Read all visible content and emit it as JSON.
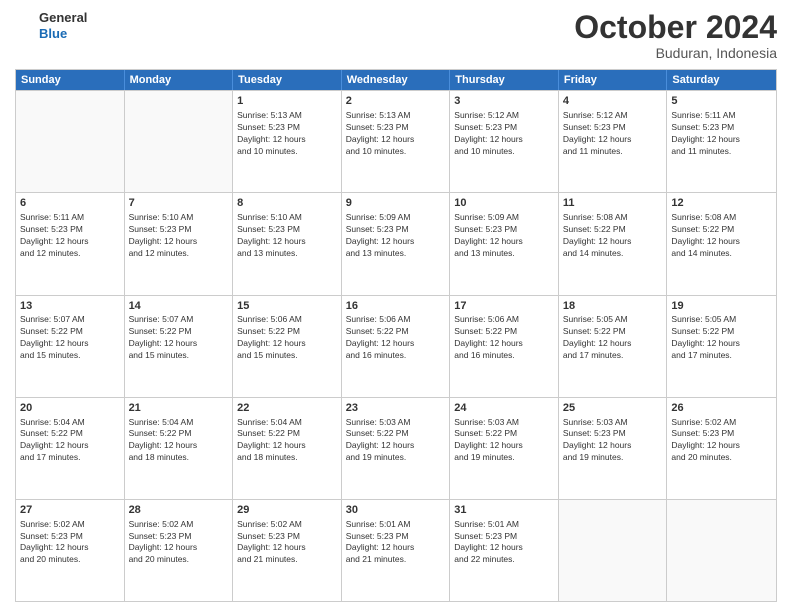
{
  "logo": {
    "line1": "General",
    "line2": "Blue"
  },
  "header": {
    "month": "October 2024",
    "location": "Buduran, Indonesia"
  },
  "days_of_week": [
    "Sunday",
    "Monday",
    "Tuesday",
    "Wednesday",
    "Thursday",
    "Friday",
    "Saturday"
  ],
  "weeks": [
    [
      {
        "day": "",
        "info": ""
      },
      {
        "day": "",
        "info": ""
      },
      {
        "day": "1",
        "info": "Sunrise: 5:13 AM\nSunset: 5:23 PM\nDaylight: 12 hours\nand 10 minutes."
      },
      {
        "day": "2",
        "info": "Sunrise: 5:13 AM\nSunset: 5:23 PM\nDaylight: 12 hours\nand 10 minutes."
      },
      {
        "day": "3",
        "info": "Sunrise: 5:12 AM\nSunset: 5:23 PM\nDaylight: 12 hours\nand 10 minutes."
      },
      {
        "day": "4",
        "info": "Sunrise: 5:12 AM\nSunset: 5:23 PM\nDaylight: 12 hours\nand 11 minutes."
      },
      {
        "day": "5",
        "info": "Sunrise: 5:11 AM\nSunset: 5:23 PM\nDaylight: 12 hours\nand 11 minutes."
      }
    ],
    [
      {
        "day": "6",
        "info": "Sunrise: 5:11 AM\nSunset: 5:23 PM\nDaylight: 12 hours\nand 12 minutes."
      },
      {
        "day": "7",
        "info": "Sunrise: 5:10 AM\nSunset: 5:23 PM\nDaylight: 12 hours\nand 12 minutes."
      },
      {
        "day": "8",
        "info": "Sunrise: 5:10 AM\nSunset: 5:23 PM\nDaylight: 12 hours\nand 13 minutes."
      },
      {
        "day": "9",
        "info": "Sunrise: 5:09 AM\nSunset: 5:23 PM\nDaylight: 12 hours\nand 13 minutes."
      },
      {
        "day": "10",
        "info": "Sunrise: 5:09 AM\nSunset: 5:23 PM\nDaylight: 12 hours\nand 13 minutes."
      },
      {
        "day": "11",
        "info": "Sunrise: 5:08 AM\nSunset: 5:22 PM\nDaylight: 12 hours\nand 14 minutes."
      },
      {
        "day": "12",
        "info": "Sunrise: 5:08 AM\nSunset: 5:22 PM\nDaylight: 12 hours\nand 14 minutes."
      }
    ],
    [
      {
        "day": "13",
        "info": "Sunrise: 5:07 AM\nSunset: 5:22 PM\nDaylight: 12 hours\nand 15 minutes."
      },
      {
        "day": "14",
        "info": "Sunrise: 5:07 AM\nSunset: 5:22 PM\nDaylight: 12 hours\nand 15 minutes."
      },
      {
        "day": "15",
        "info": "Sunrise: 5:06 AM\nSunset: 5:22 PM\nDaylight: 12 hours\nand 15 minutes."
      },
      {
        "day": "16",
        "info": "Sunrise: 5:06 AM\nSunset: 5:22 PM\nDaylight: 12 hours\nand 16 minutes."
      },
      {
        "day": "17",
        "info": "Sunrise: 5:06 AM\nSunset: 5:22 PM\nDaylight: 12 hours\nand 16 minutes."
      },
      {
        "day": "18",
        "info": "Sunrise: 5:05 AM\nSunset: 5:22 PM\nDaylight: 12 hours\nand 17 minutes."
      },
      {
        "day": "19",
        "info": "Sunrise: 5:05 AM\nSunset: 5:22 PM\nDaylight: 12 hours\nand 17 minutes."
      }
    ],
    [
      {
        "day": "20",
        "info": "Sunrise: 5:04 AM\nSunset: 5:22 PM\nDaylight: 12 hours\nand 17 minutes."
      },
      {
        "day": "21",
        "info": "Sunrise: 5:04 AM\nSunset: 5:22 PM\nDaylight: 12 hours\nand 18 minutes."
      },
      {
        "day": "22",
        "info": "Sunrise: 5:04 AM\nSunset: 5:22 PM\nDaylight: 12 hours\nand 18 minutes."
      },
      {
        "day": "23",
        "info": "Sunrise: 5:03 AM\nSunset: 5:22 PM\nDaylight: 12 hours\nand 19 minutes."
      },
      {
        "day": "24",
        "info": "Sunrise: 5:03 AM\nSunset: 5:22 PM\nDaylight: 12 hours\nand 19 minutes."
      },
      {
        "day": "25",
        "info": "Sunrise: 5:03 AM\nSunset: 5:23 PM\nDaylight: 12 hours\nand 19 minutes."
      },
      {
        "day": "26",
        "info": "Sunrise: 5:02 AM\nSunset: 5:23 PM\nDaylight: 12 hours\nand 20 minutes."
      }
    ],
    [
      {
        "day": "27",
        "info": "Sunrise: 5:02 AM\nSunset: 5:23 PM\nDaylight: 12 hours\nand 20 minutes."
      },
      {
        "day": "28",
        "info": "Sunrise: 5:02 AM\nSunset: 5:23 PM\nDaylight: 12 hours\nand 20 minutes."
      },
      {
        "day": "29",
        "info": "Sunrise: 5:02 AM\nSunset: 5:23 PM\nDaylight: 12 hours\nand 21 minutes."
      },
      {
        "day": "30",
        "info": "Sunrise: 5:01 AM\nSunset: 5:23 PM\nDaylight: 12 hours\nand 21 minutes."
      },
      {
        "day": "31",
        "info": "Sunrise: 5:01 AM\nSunset: 5:23 PM\nDaylight: 12 hours\nand 22 minutes."
      },
      {
        "day": "",
        "info": ""
      },
      {
        "day": "",
        "info": ""
      }
    ]
  ]
}
